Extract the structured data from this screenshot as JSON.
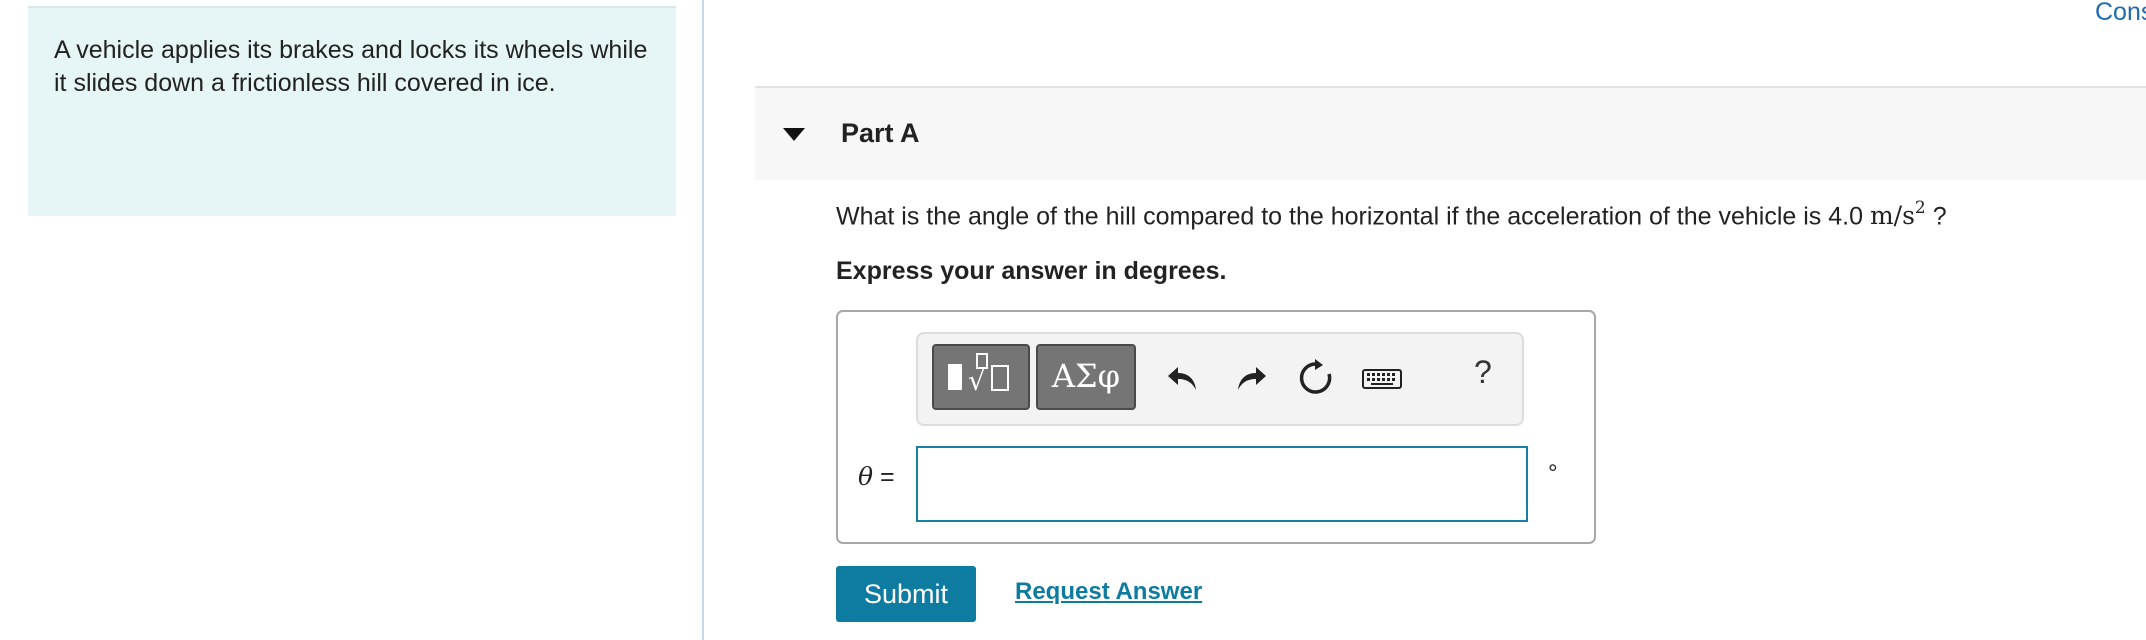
{
  "problem": {
    "text": "A vehicle applies its brakes and locks its wheels while it slides down a frictionless hill covered in ice."
  },
  "header": {
    "cons_link": "Cons"
  },
  "part": {
    "title": "Part A",
    "question_prefix": "What is the angle of the hill compared to the horizontal if the acceleration of the vehicle is 4.0",
    "question_unit_base": "m/s",
    "question_unit_exp": "2",
    "question_suffix": "?",
    "instruction": "Express your answer in degrees."
  },
  "answer": {
    "variable": "θ",
    "equals": "=",
    "value": "",
    "unit": "°"
  },
  "toolbar": {
    "templates_icon": "templates-icon",
    "symbols_label": "ΑΣφ",
    "undo_icon": "undo-icon",
    "redo_icon": "redo-icon",
    "reset_icon": "reset-icon",
    "keyboard_icon": "keyboard-icon",
    "help_label": "?"
  },
  "actions": {
    "submit_label": "Submit",
    "request_label": "Request Answer"
  },
  "colors": {
    "accent": "#0e7ba1",
    "problem_bg": "#e6f5f5",
    "link": "#1f6bb0"
  }
}
